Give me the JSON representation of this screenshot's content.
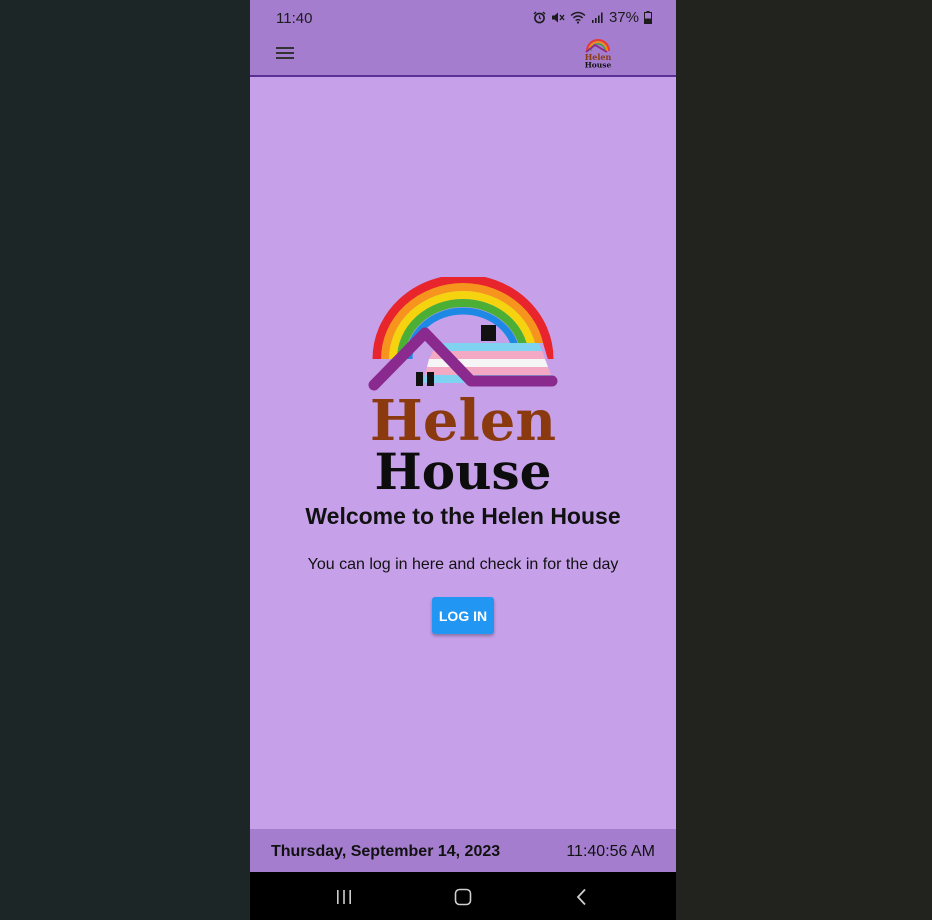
{
  "status_bar": {
    "time": "11:40",
    "battery": "37%",
    "icons": [
      "alarm-icon",
      "mute-icon",
      "wifi-icon",
      "signal-icon",
      "battery-icon"
    ]
  },
  "app_bar": {
    "menu_icon": "menu-icon",
    "logo_top": "Helen",
    "logo_bottom": "House"
  },
  "hero": {
    "logo_top": "Helen",
    "logo_bottom": "House",
    "title": "Welcome to the Helen House",
    "subtitle": "You can log in here and check in for the day",
    "login_label": "LOG IN"
  },
  "footer": {
    "date": "Thursday, September 14, 2023",
    "time": "11:40:56 AM"
  },
  "nav_bar": {
    "buttons": [
      "recent-apps-icon",
      "home-icon",
      "back-icon"
    ]
  },
  "colors": {
    "page_bg": "#c6a1ea",
    "bar_bg": "#a47dce",
    "accent": "#2196f3",
    "logo_brown": "#8b3a0f",
    "logo_purple": "#8a2a8e"
  }
}
